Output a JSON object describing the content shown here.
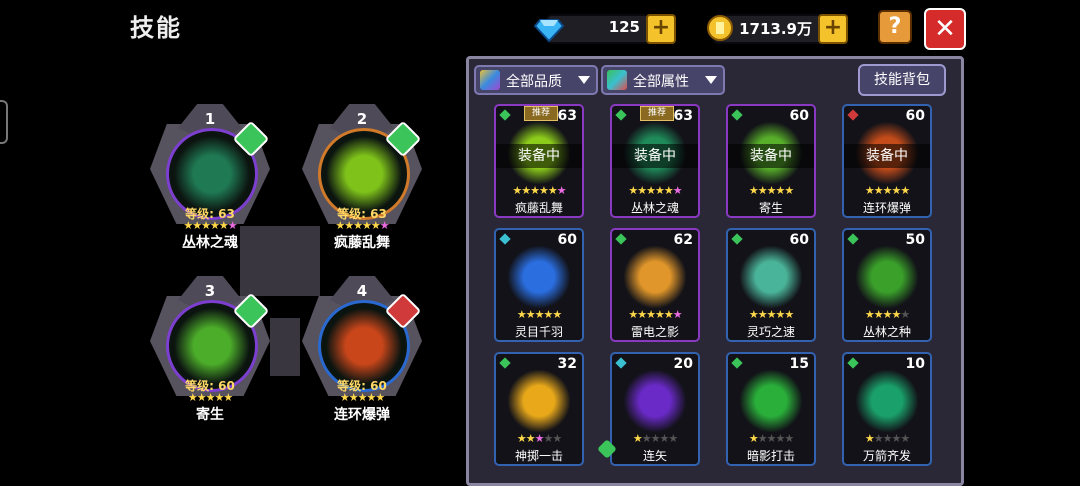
{
  "title": "技能",
  "currency": {
    "gems": "125",
    "gold": "1713.9万",
    "plus_label": "+"
  },
  "buttons": {
    "help": "?",
    "close": "✕"
  },
  "equipped": [
    {
      "slot": "1",
      "level": "等级: 63",
      "name": "丛林之魂",
      "rarity_color": "#3bc45a",
      "art_color": "#1f7a54",
      "ring": "#7d3fd0",
      "stars_on": 5,
      "pink": 1
    },
    {
      "slot": "2",
      "level": "等级: 63",
      "name": "疯藤乱舞",
      "rarity_color": "#3bc45a",
      "art_color": "#7ec21a",
      "ring": "#d07a2a",
      "stars_on": 5,
      "pink": 1
    },
    {
      "slot": "3",
      "level": "等级: 60",
      "name": "寄生",
      "rarity_color": "#3bc45a",
      "art_color": "#4cad2a",
      "ring": "#7d3fd0",
      "stars_on": 5,
      "pink": 0
    },
    {
      "slot": "4",
      "level": "等级: 60",
      "name": "连环爆弹",
      "rarity_color": "#d03a3a",
      "art_color": "#c8461a",
      "ring": "#2a6ad0",
      "stars_on": 5,
      "pink": 0
    }
  ],
  "filters": {
    "quality": "全部品质",
    "attribute": "全部属性",
    "bag": "技能背包"
  },
  "equipped_label": "装备中",
  "recommend_label": "推荐",
  "skills": [
    {
      "name": "疯藤乱舞",
      "level": "63",
      "border": "purple",
      "gem": "#3bc45a",
      "art": "#8ccc1a",
      "stars": [
        1,
        1,
        1,
        1,
        1,
        2
      ],
      "equipped": true,
      "recommended": true
    },
    {
      "name": "丛林之魂",
      "level": "63",
      "border": "purple",
      "gem": "#3bc45a",
      "art": "#1f8a5a",
      "stars": [
        1,
        1,
        1,
        1,
        1,
        2
      ],
      "equipped": true,
      "recommended": true
    },
    {
      "name": "寄生",
      "level": "60",
      "border": "purple",
      "gem": "#3bc45a",
      "art": "#58b02a",
      "stars": [
        1,
        1,
        1,
        1,
        1
      ],
      "equipped": true,
      "recommended": false
    },
    {
      "name": "连环爆弹",
      "level": "60",
      "border": "blue",
      "gem": "#d03a3a",
      "art": "#c44c1a",
      "stars": [
        1,
        1,
        1,
        1,
        1
      ],
      "equipped": true,
      "recommended": false
    },
    {
      "name": "灵目千羽",
      "level": "60",
      "border": "blue",
      "gem": "#3ac0d0",
      "art": "#2a6ee0",
      "stars": [
        1,
        1,
        1,
        1,
        1
      ],
      "equipped": false,
      "recommended": false
    },
    {
      "name": "雷电之影",
      "level": "62",
      "border": "purple",
      "gem": "#3bc45a",
      "art": "#e0962a",
      "stars": [
        1,
        1,
        1,
        1,
        1,
        2
      ],
      "equipped": false,
      "recommended": false
    },
    {
      "name": "灵巧之速",
      "level": "60",
      "border": "blue",
      "gem": "#3bc45a",
      "art": "#4ab49a",
      "stars": [
        1,
        1,
        1,
        1,
        1
      ],
      "equipped": false,
      "recommended": false
    },
    {
      "name": "丛林之种",
      "level": "50",
      "border": "blue",
      "gem": "#3bc45a",
      "art": "#3aa02a",
      "stars": [
        1,
        1,
        1,
        1,
        0
      ],
      "equipped": false,
      "recommended": false
    },
    {
      "name": "神掷一击",
      "level": "32",
      "border": "blue",
      "gem": "#3bc45a",
      "art": "#e8a81a",
      "stars": [
        1,
        1,
        2,
        0,
        0
      ],
      "equipped": false,
      "recommended": false
    },
    {
      "name": "连矢",
      "level": "20",
      "border": "blue",
      "gem": "#3ac0d0",
      "art": "#6a2ac8",
      "stars": [
        1,
        0,
        0,
        0,
        0
      ],
      "equipped": false,
      "recommended": false
    },
    {
      "name": "暗影打击",
      "level": "15",
      "border": "blue",
      "gem": "#3bc45a",
      "art": "#2ab03a",
      "stars": [
        1,
        0,
        0,
        0,
        0
      ],
      "equipped": false,
      "recommended": false
    },
    {
      "name": "万箭齐发",
      "level": "10",
      "border": "blue",
      "gem": "#3bc45a",
      "art": "#1aa06a",
      "stars": [
        1,
        0,
        0,
        0,
        0
      ],
      "equipped": false,
      "recommended": false
    }
  ]
}
